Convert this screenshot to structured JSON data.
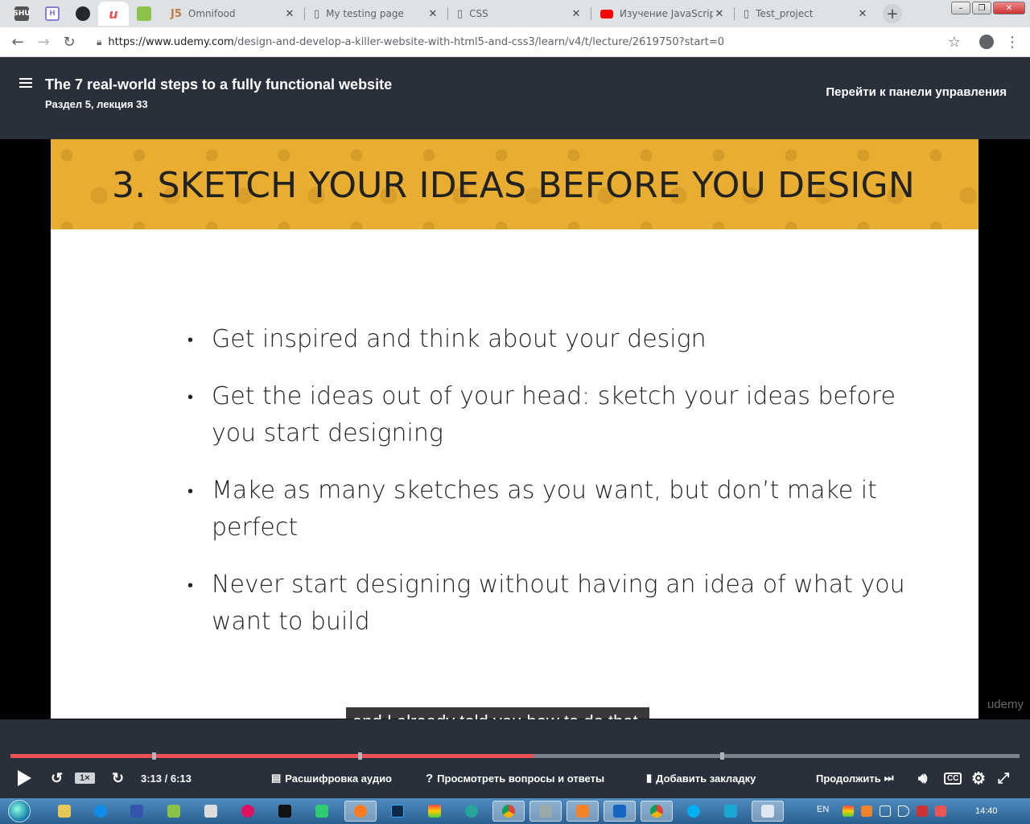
{
  "browser": {
    "pinned_tabs": [
      {
        "name": "shu-blog",
        "label": "SHU\nblog",
        "color": "#555555"
      },
      {
        "name": "h-tab",
        "label": "H",
        "color": "#8b7bd3"
      },
      {
        "name": "github",
        "label": "",
        "color": "#24292e"
      },
      {
        "name": "udemy",
        "label": "u",
        "color": "#ec5252"
      },
      {
        "name": "green-tab",
        "label": "",
        "color": "#8bc34a"
      }
    ],
    "tabs": [
      {
        "title": "Omnifood",
        "icon": "js-icon",
        "color": "#c07a3e"
      },
      {
        "title": "My testing page",
        "icon": "document-icon",
        "color": "#5f6368"
      },
      {
        "title": "CSS",
        "icon": "document-icon",
        "color": "#5f6368"
      },
      {
        "title": "Изучение JavaScript",
        "icon": "youtube-icon",
        "color": "#ff0000"
      },
      {
        "title": "Test_project",
        "icon": "document-icon",
        "color": "#5f6368"
      }
    ],
    "url_host": "https://www.udemy.com",
    "url_path": "/design-and-develop-a-killer-website-with-html5-and-css3/learn/v4/t/lecture/2619750?start=0"
  },
  "header": {
    "title": "The 7 real-world steps to a fully functional website",
    "subtitle": "Раздел 5, лекция 33",
    "dashboard_link": "Перейти к панели управления"
  },
  "slide": {
    "title": "3. SKETCH YOUR IDEAS BEFORE YOU DESIGN",
    "bullets": [
      "Get inspired and think about your design",
      "Get the ideas out of your head: sketch your ideas before you start designing",
      "Make as many sketches as you want, but don’t make it perfect",
      "Never start designing without having an idea of what you want to build"
    ],
    "watermark": "udemy",
    "accent": "#e8ad31"
  },
  "caption": "and I already told you how to do that.",
  "player": {
    "progress": 0.518,
    "speed": "1×",
    "time": "3:13 / 6:13",
    "transcript": "Расшифровка аудио",
    "questions": "Просмотреть вопросы и ответы",
    "bookmark": "Добавить закладку",
    "continue": "Продолжить",
    "cc": "CC",
    "accent": "#ec5252"
  },
  "taskbar": {
    "language": "EN",
    "clock": "14:40"
  }
}
